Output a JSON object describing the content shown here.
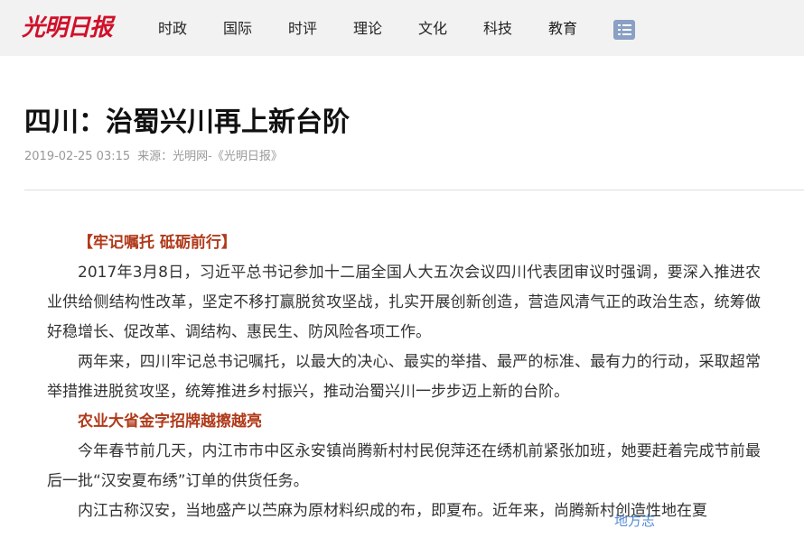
{
  "header": {
    "logo_text": "光明日报",
    "nav": [
      "时政",
      "国际",
      "时评",
      "理论",
      "文化",
      "科技",
      "教育"
    ]
  },
  "article": {
    "title": "四川：治蜀兴川再上新台阶",
    "date": "2019-02-25 03:15",
    "source": "来源：光明网-《光明日报》",
    "paragraphs": [
      {
        "type": "subheading",
        "text": "【牢记嘱托 砥砺前行】"
      },
      {
        "type": "body",
        "text": "2017年3月8日，习近平总书记参加十二届全国人大五次会议四川代表团审议时强调，要深入推进农业供给侧结构性改革，坚定不移打赢脱贫攻坚战，扎实开展创新创造，营造风清气正的政治生态，统筹做好稳增长、促改革、调结构、惠民生、防风险各项工作。"
      },
      {
        "type": "body",
        "text": "两年来，四川牢记总书记嘱托，以最大的决心、最实的举措、最严的标准、最有力的行动，采取超常举措推进脱贫攻坚，统筹推进乡村振兴，推动治蜀兴川一步步迈上新的台阶。"
      },
      {
        "type": "subheading",
        "text": "农业大省金字招牌越擦越亮"
      },
      {
        "type": "body",
        "text": "今年春节前几天，内江市市中区永安镇尚腾新村村民倪萍还在绣机前紧张加班，她要赶着完成节前最后一批“汉安夏布绣”订单的供货任务。"
      },
      {
        "type": "body",
        "text": "内江古称汉安，当地盛产以苎麻为原材料织成的布，即夏布。近年来，尚腾新村创造性地在夏"
      }
    ]
  },
  "watermark": "地方志"
}
